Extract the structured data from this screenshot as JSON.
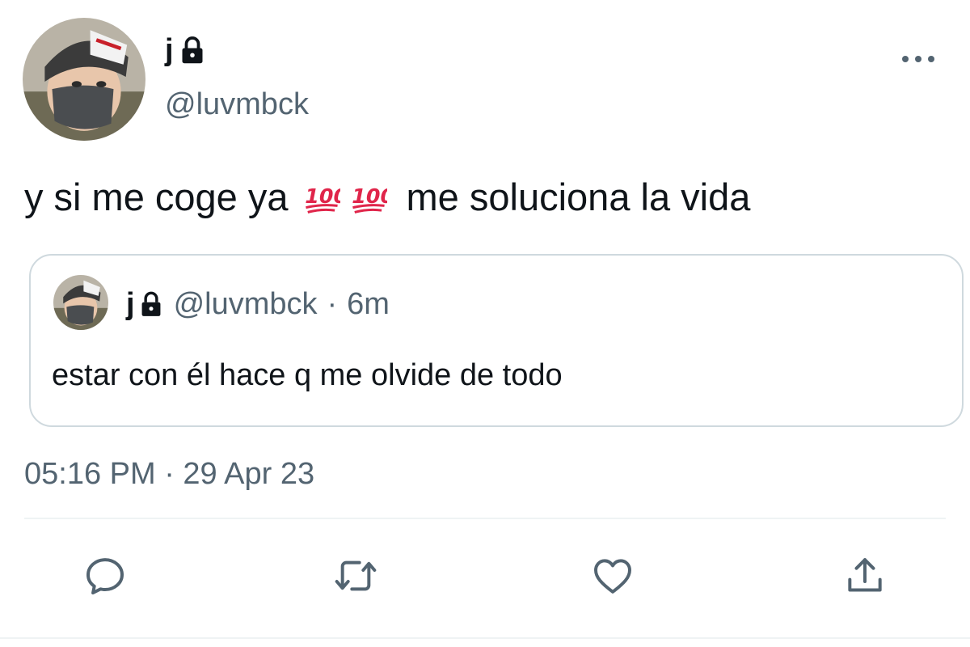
{
  "author": {
    "display_name": "j",
    "handle": "@luvmbck",
    "protected": true
  },
  "tweet": {
    "text_before": "y si me coge ya",
    "emoji": "hundred-points",
    "emoji_count": 2,
    "text_after": "me soluciona la vida",
    "timestamp": "05:16 PM · 29 Apr 23"
  },
  "quoted_tweet": {
    "display_name": "j",
    "handle": "@luvmbck",
    "separator": "·",
    "time_ago": "6m",
    "text": "estar con él hace q me olvide de todo"
  },
  "actions": [
    {
      "name": "reply",
      "icon": "reply-icon"
    },
    {
      "name": "retweet",
      "icon": "retweet-icon"
    },
    {
      "name": "like",
      "icon": "heart-icon"
    },
    {
      "name": "share",
      "icon": "share-icon"
    }
  ],
  "colors": {
    "text": "#0f1419",
    "secondary": "#536471",
    "border": "#cfd9de",
    "divider": "#eff3f4",
    "emoji_red": "#e0254a"
  }
}
